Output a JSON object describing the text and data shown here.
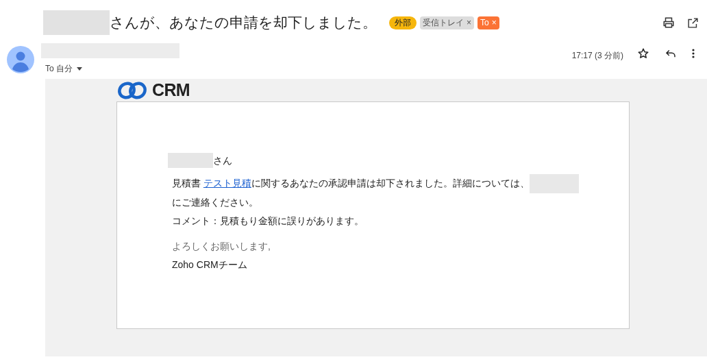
{
  "subject": {
    "text": "さんが、あなたの申請を却下しました。"
  },
  "labels": [
    {
      "text": "外部",
      "color": "#f6b60c",
      "removable": false
    },
    {
      "text": "受信トレイ",
      "color": "#dddddd",
      "removable": true
    },
    {
      "text": "To",
      "color": "#fb7335",
      "removable": true
    }
  ],
  "remove_glyph": "×",
  "recipient": {
    "text": "To 自分"
  },
  "time": "17:17 (3 分前)",
  "starred": false,
  "logo": {
    "text": "CRM"
  },
  "body": {
    "greeting_suffix": "さん",
    "lead": "見積書 ",
    "link": "テスト見積",
    "rest": "に関するあなたの承認申請は却下されました。詳細については、",
    "tail": "にご連絡ください。",
    "comment": "コメント：見積もり金額に誤りがあります。",
    "closing": "よろしくお願いします,",
    "signature": "Zoho CRMチーム"
  }
}
